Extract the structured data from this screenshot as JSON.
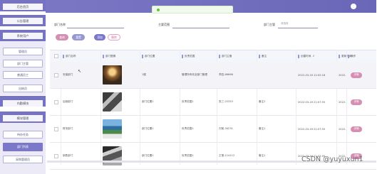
{
  "header": {
    "title": "",
    "toast": "",
    "user": ""
  },
  "sidebar": {
    "groups": [
      {
        "label": "后台首页"
      },
      {
        "label": "公告管理"
      },
      {
        "label": "系统用户"
      },
      {
        "label": "内勤模块"
      },
      {
        "label": "模块管理"
      }
    ],
    "items": [
      {
        "label": "管理员"
      },
      {
        "label": "部门主管"
      },
      {
        "label": "普通员工"
      },
      {
        "label": "出纳员"
      },
      {
        "label": "待办任务"
      },
      {
        "label": "部门列表"
      },
      {
        "label": "采购管理员"
      }
    ]
  },
  "filters": {
    "dept_name_label": "部门名称",
    "duty_label": "主要范围",
    "supervisor_label": "部门主管",
    "supervisor_placeholder": "请选择"
  },
  "toolbar": {
    "search": "查询",
    "reset": "重置",
    "add": "添加",
    "delete": "删除"
  },
  "table": {
    "columns": [
      "部门名称",
      "部门图像",
      "部门位置",
      "负责范围",
      "部门主管",
      "备注",
      "创建时间",
      "更新时间",
      "操作"
    ],
    "rows": [
      {
        "name": "安保部门",
        "location": "1楼",
        "scope": "管理所有安全部门管理",
        "supervisor": "李四-66666",
        "note": "",
        "created": "2022-03-16 12:02:18",
        "updated": "2022-03-16 12:02:18",
        "action": "详情"
      },
      {
        "name": "后勤部门",
        "location": "部门位置1",
        "scope": "负责范围1",
        "supervisor": "张三-22222",
        "note": "备注1",
        "created": "2022-03-16 21:07:55",
        "updated": "2022-03-16 21:07:55",
        "action": "详情"
      },
      {
        "name": "财务部门",
        "location": "部门位置1",
        "scope": "负责范围1",
        "supervisor": "刘某-34231",
        "note": "备注1",
        "created": "2022-03-16 21:07:55",
        "updated": "2022-03-16 21:07:55",
        "action": "详情"
      },
      {
        "name": "销售部门",
        "location": "部门位置1",
        "scope": "负责范围1",
        "supervisor": "王丽-114112",
        "note": "备注1",
        "created": "2022-03-16 21:07:55",
        "updated": "2022-03-16 21:07:55",
        "action": "详情"
      }
    ]
  },
  "watermark": "CSDN @yuyuxun1",
  "colors": {
    "accent": "#7a76c9",
    "pink": "#d48fb3"
  }
}
